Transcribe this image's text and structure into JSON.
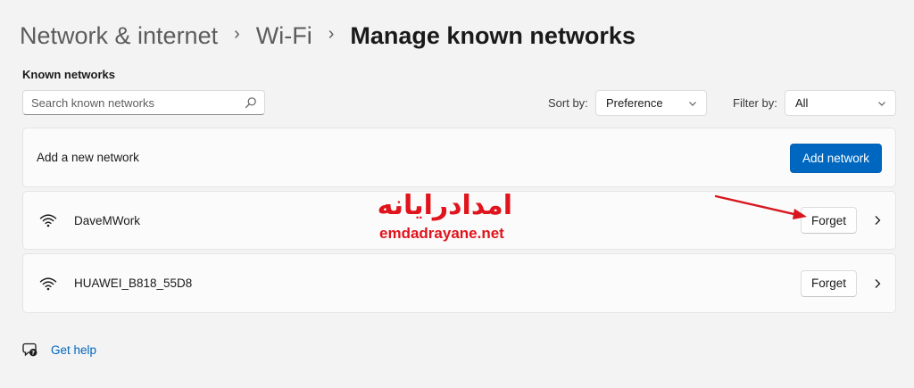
{
  "breadcrumb": {
    "items": [
      "Network & internet",
      "Wi-Fi"
    ],
    "separator": "›",
    "current": "Manage known networks"
  },
  "section": {
    "title": "Known networks"
  },
  "search": {
    "placeholder": "Search known networks",
    "value": "",
    "icon": "search-icon"
  },
  "sort": {
    "label": "Sort by:",
    "value": "Preference"
  },
  "filter": {
    "label": "Filter by:",
    "value": "All"
  },
  "add_network": {
    "label": "Add a new network",
    "button": "Add network"
  },
  "networks": [
    {
      "name": "DaveMWork",
      "forget_label": "Forget",
      "icon": "wifi-icon"
    },
    {
      "name": "HUAWEI_B818_55D8",
      "forget_label": "Forget",
      "icon": "wifi-icon"
    }
  ],
  "watermark": {
    "persian": "امدادرایانه",
    "domain": "emdadrayane.net"
  },
  "help": {
    "label": "Get help",
    "icon": "help-chat-icon"
  },
  "colors": {
    "accent": "#0067c0",
    "background": "#f3f3f3",
    "card": "#fbfbfb",
    "watermark": "#e0141c"
  }
}
